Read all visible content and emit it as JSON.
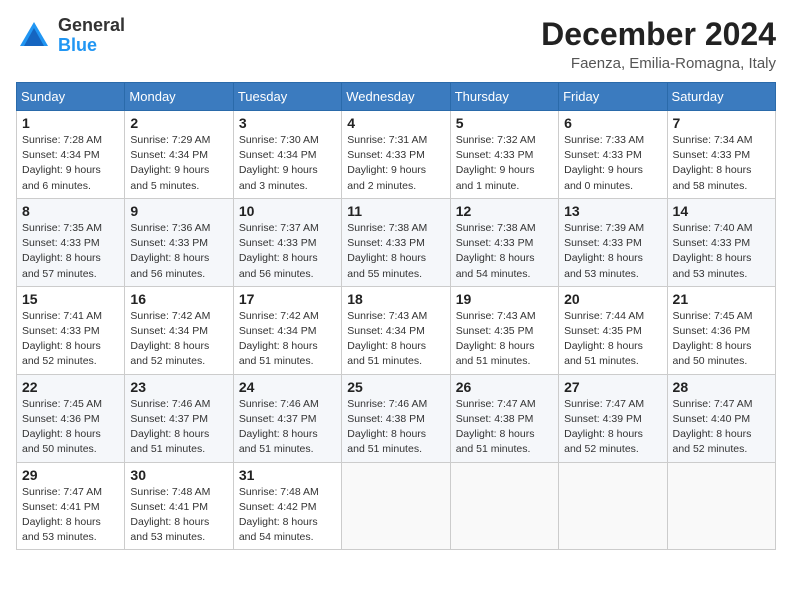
{
  "header": {
    "logo_general": "General",
    "logo_blue": "Blue",
    "title": "December 2024",
    "subtitle": "Faenza, Emilia-Romagna, Italy"
  },
  "calendar": {
    "days_of_week": [
      "Sunday",
      "Monday",
      "Tuesday",
      "Wednesday",
      "Thursday",
      "Friday",
      "Saturday"
    ],
    "weeks": [
      [
        {
          "day": "1",
          "detail": "Sunrise: 7:28 AM\nSunset: 4:34 PM\nDaylight: 9 hours\nand 6 minutes."
        },
        {
          "day": "2",
          "detail": "Sunrise: 7:29 AM\nSunset: 4:34 PM\nDaylight: 9 hours\nand 5 minutes."
        },
        {
          "day": "3",
          "detail": "Sunrise: 7:30 AM\nSunset: 4:34 PM\nDaylight: 9 hours\nand 3 minutes."
        },
        {
          "day": "4",
          "detail": "Sunrise: 7:31 AM\nSunset: 4:33 PM\nDaylight: 9 hours\nand 2 minutes."
        },
        {
          "day": "5",
          "detail": "Sunrise: 7:32 AM\nSunset: 4:33 PM\nDaylight: 9 hours\nand 1 minute."
        },
        {
          "day": "6",
          "detail": "Sunrise: 7:33 AM\nSunset: 4:33 PM\nDaylight: 9 hours\nand 0 minutes."
        },
        {
          "day": "7",
          "detail": "Sunrise: 7:34 AM\nSunset: 4:33 PM\nDaylight: 8 hours\nand 58 minutes."
        }
      ],
      [
        {
          "day": "8",
          "detail": "Sunrise: 7:35 AM\nSunset: 4:33 PM\nDaylight: 8 hours\nand 57 minutes."
        },
        {
          "day": "9",
          "detail": "Sunrise: 7:36 AM\nSunset: 4:33 PM\nDaylight: 8 hours\nand 56 minutes."
        },
        {
          "day": "10",
          "detail": "Sunrise: 7:37 AM\nSunset: 4:33 PM\nDaylight: 8 hours\nand 56 minutes."
        },
        {
          "day": "11",
          "detail": "Sunrise: 7:38 AM\nSunset: 4:33 PM\nDaylight: 8 hours\nand 55 minutes."
        },
        {
          "day": "12",
          "detail": "Sunrise: 7:38 AM\nSunset: 4:33 PM\nDaylight: 8 hours\nand 54 minutes."
        },
        {
          "day": "13",
          "detail": "Sunrise: 7:39 AM\nSunset: 4:33 PM\nDaylight: 8 hours\nand 53 minutes."
        },
        {
          "day": "14",
          "detail": "Sunrise: 7:40 AM\nSunset: 4:33 PM\nDaylight: 8 hours\nand 53 minutes."
        }
      ],
      [
        {
          "day": "15",
          "detail": "Sunrise: 7:41 AM\nSunset: 4:33 PM\nDaylight: 8 hours\nand 52 minutes."
        },
        {
          "day": "16",
          "detail": "Sunrise: 7:42 AM\nSunset: 4:34 PM\nDaylight: 8 hours\nand 52 minutes."
        },
        {
          "day": "17",
          "detail": "Sunrise: 7:42 AM\nSunset: 4:34 PM\nDaylight: 8 hours\nand 51 minutes."
        },
        {
          "day": "18",
          "detail": "Sunrise: 7:43 AM\nSunset: 4:34 PM\nDaylight: 8 hours\nand 51 minutes."
        },
        {
          "day": "19",
          "detail": "Sunrise: 7:43 AM\nSunset: 4:35 PM\nDaylight: 8 hours\nand 51 minutes."
        },
        {
          "day": "20",
          "detail": "Sunrise: 7:44 AM\nSunset: 4:35 PM\nDaylight: 8 hours\nand 51 minutes."
        },
        {
          "day": "21",
          "detail": "Sunrise: 7:45 AM\nSunset: 4:36 PM\nDaylight: 8 hours\nand 50 minutes."
        }
      ],
      [
        {
          "day": "22",
          "detail": "Sunrise: 7:45 AM\nSunset: 4:36 PM\nDaylight: 8 hours\nand 50 minutes."
        },
        {
          "day": "23",
          "detail": "Sunrise: 7:46 AM\nSunset: 4:37 PM\nDaylight: 8 hours\nand 51 minutes."
        },
        {
          "day": "24",
          "detail": "Sunrise: 7:46 AM\nSunset: 4:37 PM\nDaylight: 8 hours\nand 51 minutes."
        },
        {
          "day": "25",
          "detail": "Sunrise: 7:46 AM\nSunset: 4:38 PM\nDaylight: 8 hours\nand 51 minutes."
        },
        {
          "day": "26",
          "detail": "Sunrise: 7:47 AM\nSunset: 4:38 PM\nDaylight: 8 hours\nand 51 minutes."
        },
        {
          "day": "27",
          "detail": "Sunrise: 7:47 AM\nSunset: 4:39 PM\nDaylight: 8 hours\nand 52 minutes."
        },
        {
          "day": "28",
          "detail": "Sunrise: 7:47 AM\nSunset: 4:40 PM\nDaylight: 8 hours\nand 52 minutes."
        }
      ],
      [
        {
          "day": "29",
          "detail": "Sunrise: 7:47 AM\nSunset: 4:41 PM\nDaylight: 8 hours\nand 53 minutes."
        },
        {
          "day": "30",
          "detail": "Sunrise: 7:48 AM\nSunset: 4:41 PM\nDaylight: 8 hours\nand 53 minutes."
        },
        {
          "day": "31",
          "detail": "Sunrise: 7:48 AM\nSunset: 4:42 PM\nDaylight: 8 hours\nand 54 minutes."
        },
        null,
        null,
        null,
        null
      ]
    ]
  }
}
